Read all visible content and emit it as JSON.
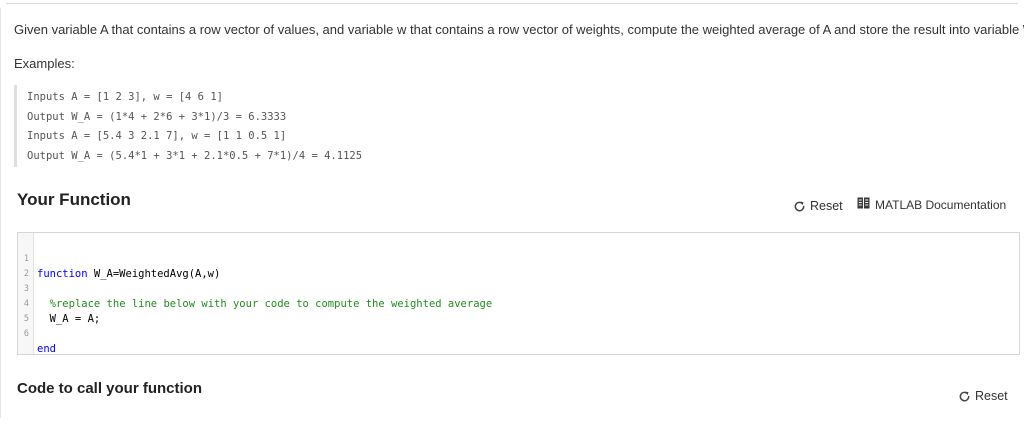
{
  "problem": {
    "description": "Given variable A that contains a row vector of values, and variable w that contains a row vector of weights, compute the weighted average of A and store the result into variable W_A",
    "examples_label": "Examples:",
    "examples": [
      "Inputs A = [1 2 3], w = [4 6 1]",
      "Output W_A = (1*4 + 2*6 + 3*1)/3 = 6.3333",
      "Inputs A = [5.4 3 2.1 7], w = [1 1 0.5 1]",
      "Output W_A = (5.4*1 + 3*1 + 2.1*0.5 + 7*1)/4 = 4.1125"
    ]
  },
  "your_function": {
    "title": "Your Function",
    "reset_label": "Reset",
    "doc_label": "MATLAB Documentation",
    "code_lines": [
      {
        "num": "1",
        "keyword": "function",
        "text": " W_A=WeightedAvg(A,w)",
        "comment": ""
      },
      {
        "num": "2",
        "keyword": "",
        "text": "",
        "comment": ""
      },
      {
        "num": "3",
        "keyword": "",
        "text": "  ",
        "comment": "%replace the line below with your code to compute the weighted average"
      },
      {
        "num": "4",
        "keyword": "",
        "text": "  W_A = A;",
        "comment": ""
      },
      {
        "num": "5",
        "keyword": "",
        "text": "",
        "comment": ""
      },
      {
        "num": "6",
        "keyword": "end",
        "text": "",
        "comment": ""
      }
    ]
  },
  "call_section": {
    "title": "Code to call your function",
    "reset_label": "Reset"
  },
  "colors": {
    "keyword": "#0000ff",
    "comment": "#228b22",
    "doc_icon": "#3a3a3a"
  },
  "icons": {
    "reset": "refresh-icon",
    "documentation": "book-icon"
  }
}
